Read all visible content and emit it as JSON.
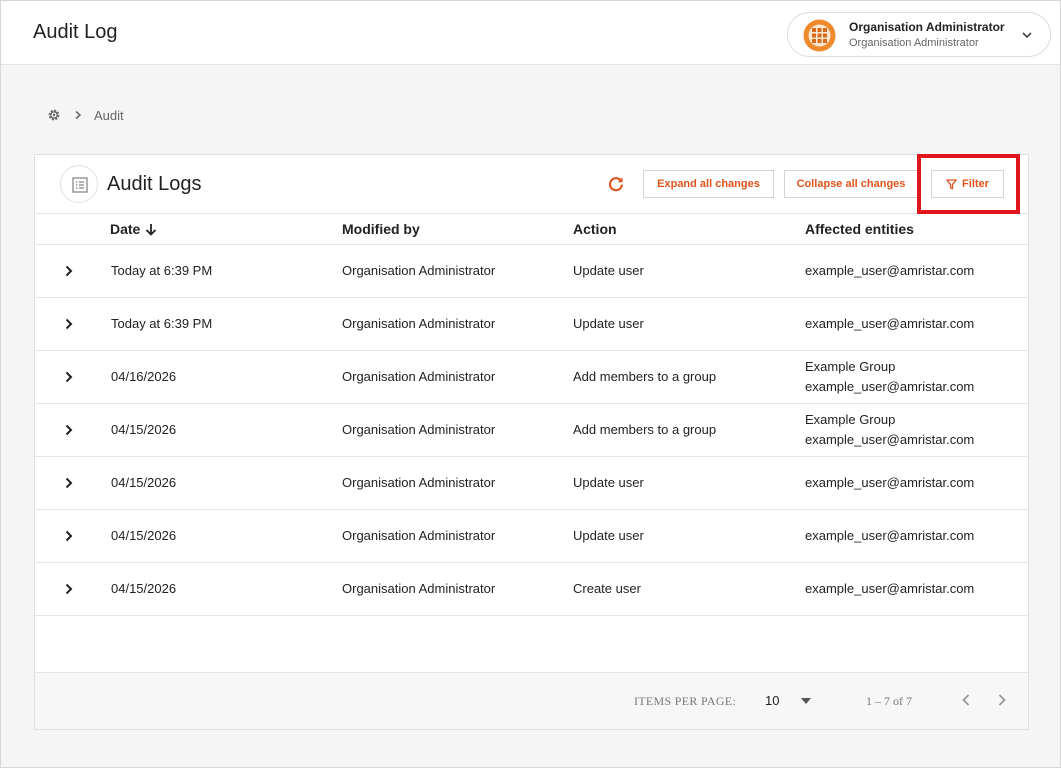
{
  "header": {
    "title": "Audit Log",
    "user": {
      "name": "Organisation Administrator",
      "role": "Organisation Administrator"
    }
  },
  "breadcrumb": {
    "current": "Audit"
  },
  "card": {
    "title": "Audit Logs",
    "expand_label": "Expand all changes",
    "collapse_label": "Collapse all changes",
    "filter_label": "Filter"
  },
  "table": {
    "columns": [
      "Date",
      "Modified by",
      "Action",
      "Affected entities"
    ],
    "rows": [
      {
        "date": "Today at 6:39 PM",
        "modified_by": "Organisation Administrator",
        "action": "Update user",
        "entities": [
          "example_user@amristar.com"
        ]
      },
      {
        "date": "Today at 6:39 PM",
        "modified_by": "Organisation Administrator",
        "action": "Update user",
        "entities": [
          "example_user@amristar.com"
        ]
      },
      {
        "date": "04/16/2026",
        "modified_by": "Organisation Administrator",
        "action": "Add members to a group",
        "entities": [
          "Example Group",
          "example_user@amristar.com"
        ]
      },
      {
        "date": "04/15/2026",
        "modified_by": "Organisation Administrator",
        "action": "Add members to a group",
        "entities": [
          "Example Group",
          "example_user@amristar.com"
        ]
      },
      {
        "date": "04/15/2026",
        "modified_by": "Organisation Administrator",
        "action": "Update user",
        "entities": [
          "example_user@amristar.com"
        ]
      },
      {
        "date": "04/15/2026",
        "modified_by": "Organisation Administrator",
        "action": "Update user",
        "entities": [
          "example_user@amristar.com"
        ]
      },
      {
        "date": "04/15/2026",
        "modified_by": "Organisation Administrator",
        "action": "Create user",
        "entities": [
          "example_user@amristar.com"
        ]
      }
    ]
  },
  "pagination": {
    "items_per_page_label": "ITEMS PER PAGE:",
    "items_per_page": "10",
    "range": "1 – 7 of 7"
  },
  "colors": {
    "accent": "#e0531c",
    "highlight": "#e0141b"
  },
  "icons": {
    "refresh": "refresh-icon",
    "filter": "filter-icon",
    "settings": "gear-icon",
    "list": "list-icon",
    "expand_row": "chevron-right-icon"
  }
}
